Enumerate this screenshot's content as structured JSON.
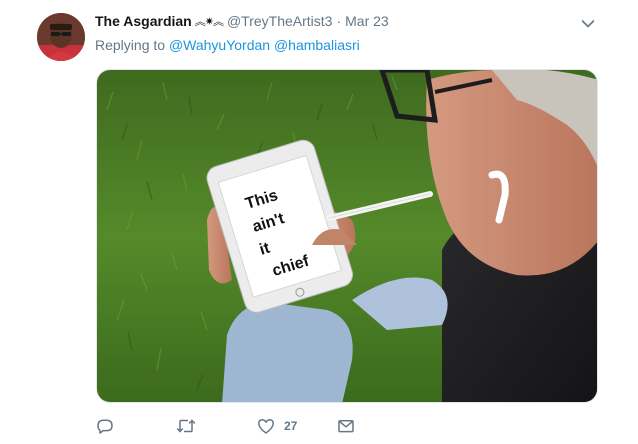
{
  "tweet": {
    "display_name": "The Asgardian",
    "name_symbols": "︽✷︽",
    "handle": "@TreyTheArtist3",
    "separator": "·",
    "time": "Mar 23",
    "replying_prefix": "Replying to",
    "mention_1": "@WahyuYordan",
    "mention_2": "@hambaliasri",
    "media_text": [
      "This",
      "ain't",
      "it",
      "chief"
    ],
    "like_count": "27"
  },
  "colors": {
    "link": "#1b95e0",
    "secondary_text": "#657786",
    "primary_text": "#14171a"
  },
  "icons": {
    "reply": "reply-icon",
    "retweet": "retweet-icon",
    "like": "heart-icon",
    "dm": "envelope-icon",
    "menu": "chevron-down-icon"
  }
}
